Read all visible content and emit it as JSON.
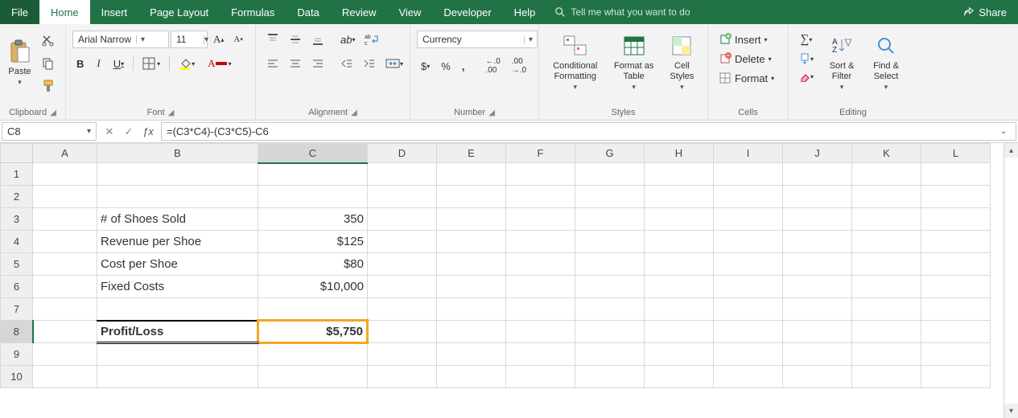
{
  "tabs": {
    "file": "File",
    "home": "Home",
    "insert": "Insert",
    "page_layout": "Page Layout",
    "formulas": "Formulas",
    "data": "Data",
    "review": "Review",
    "view": "View",
    "developer": "Developer",
    "help": "Help",
    "tellme": "Tell me what you want to do",
    "share": "Share"
  },
  "ribbon": {
    "clipboard": {
      "paste": "Paste",
      "title": "Clipboard"
    },
    "font": {
      "name": "Arial Narrow",
      "size": "11",
      "bold": "B",
      "italic": "I",
      "underline": "U",
      "title": "Font"
    },
    "alignment": {
      "title": "Alignment"
    },
    "number": {
      "format": "Currency",
      "title": "Number",
      "dollar": "$",
      "percent": "%",
      "comma": ","
    },
    "styles": {
      "conditional": "Conditional Formatting",
      "format_table": "Format as Table",
      "cell_styles": "Cell Styles",
      "title": "Styles"
    },
    "cells": {
      "insert": "Insert",
      "delete": "Delete",
      "format": "Format",
      "title": "Cells"
    },
    "editing": {
      "sort": "Sort & Filter",
      "find": "Find & Select",
      "title": "Editing"
    }
  },
  "formula_bar": {
    "name_box": "C8",
    "formula": "=(C3*C4)-(C3*C5)-C6"
  },
  "columns": [
    "A",
    "B",
    "C",
    "D",
    "E",
    "F",
    "G",
    "H",
    "I",
    "J",
    "K",
    "L"
  ],
  "rows": [
    "1",
    "2",
    "3",
    "4",
    "5",
    "6",
    "7",
    "8",
    "9",
    "10"
  ],
  "cells": {
    "B3": "# of Shoes Sold",
    "C3": "350",
    "B4": "Revenue per Shoe",
    "C4": "$125",
    "B5": "Cost per Shoe",
    "C5": "$80",
    "B6": "Fixed Costs",
    "C6": "$10,000",
    "B8": "Profit/Loss",
    "C8": "$5,750"
  },
  "selected": {
    "col": "C",
    "row": "8"
  }
}
